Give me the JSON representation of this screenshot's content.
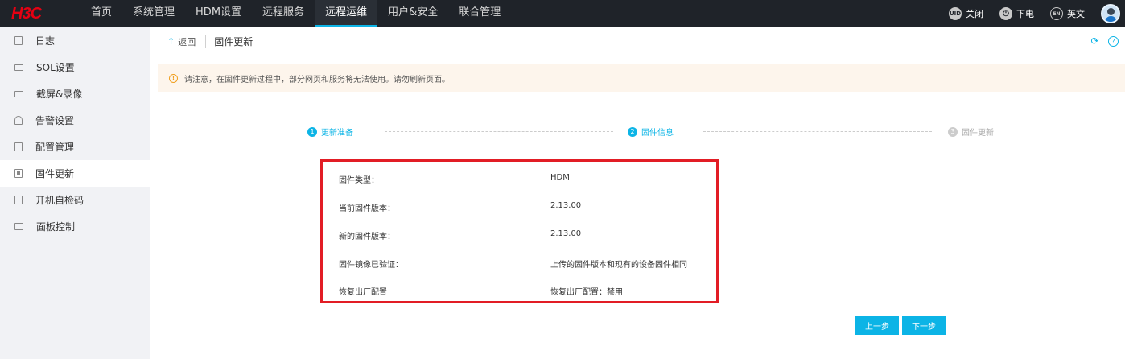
{
  "header": {
    "logo": "H3C",
    "nav": [
      "首页",
      "系统管理",
      "HDM设置",
      "远程服务",
      "远程运维",
      "用户&安全",
      "联合管理"
    ],
    "active_nav_index": 4,
    "uid_badge": "UID",
    "uid_label": "关闭",
    "power_label": "下电",
    "lang_badge": "EN",
    "lang_label": "英文"
  },
  "sidebar": {
    "items": [
      {
        "label": "日志",
        "icon": "doc-icon"
      },
      {
        "label": "SOL设置",
        "icon": "console-icon"
      },
      {
        "label": "截屏&录像",
        "icon": "video-icon"
      },
      {
        "label": "告警设置",
        "icon": "bell-icon"
      },
      {
        "label": "配置管理",
        "icon": "config-icon"
      },
      {
        "label": "固件更新",
        "icon": "chip-icon"
      },
      {
        "label": "开机自检码",
        "icon": "post-icon"
      },
      {
        "label": "面板控制",
        "icon": "panel-icon"
      }
    ],
    "active_index": 5
  },
  "breadcrumb": {
    "back_label": "返回",
    "title": "固件更新"
  },
  "notice": {
    "text": "请注意，在固件更新过程中，部分网页和服务将无法使用。请勿刷新页面。"
  },
  "steps": [
    {
      "num": "1",
      "label": "更新准备",
      "state": "done"
    },
    {
      "num": "2",
      "label": "固件信息",
      "state": "current"
    },
    {
      "num": "3",
      "label": "固件更新",
      "state": "todo"
    }
  ],
  "firmware_info": [
    {
      "key": "固件类型：",
      "value": "HDM"
    },
    {
      "key": "当前固件版本：",
      "value": "2.13.00"
    },
    {
      "key": "新的固件版本：",
      "value": "2.13.00"
    },
    {
      "key": "固件镜像已验证：",
      "value": "上传的固件版本和现有的设备固件相同"
    },
    {
      "key": "恢复出厂配置",
      "value": "恢复出厂配置：禁用"
    }
  ],
  "buttons": {
    "prev": "上一步",
    "next": "下一步"
  },
  "colors": {
    "accent": "#0cb4e6",
    "highlight_border": "#e21d25",
    "topbar": "#1f2329",
    "notice_bg": "#fdf5ec"
  }
}
